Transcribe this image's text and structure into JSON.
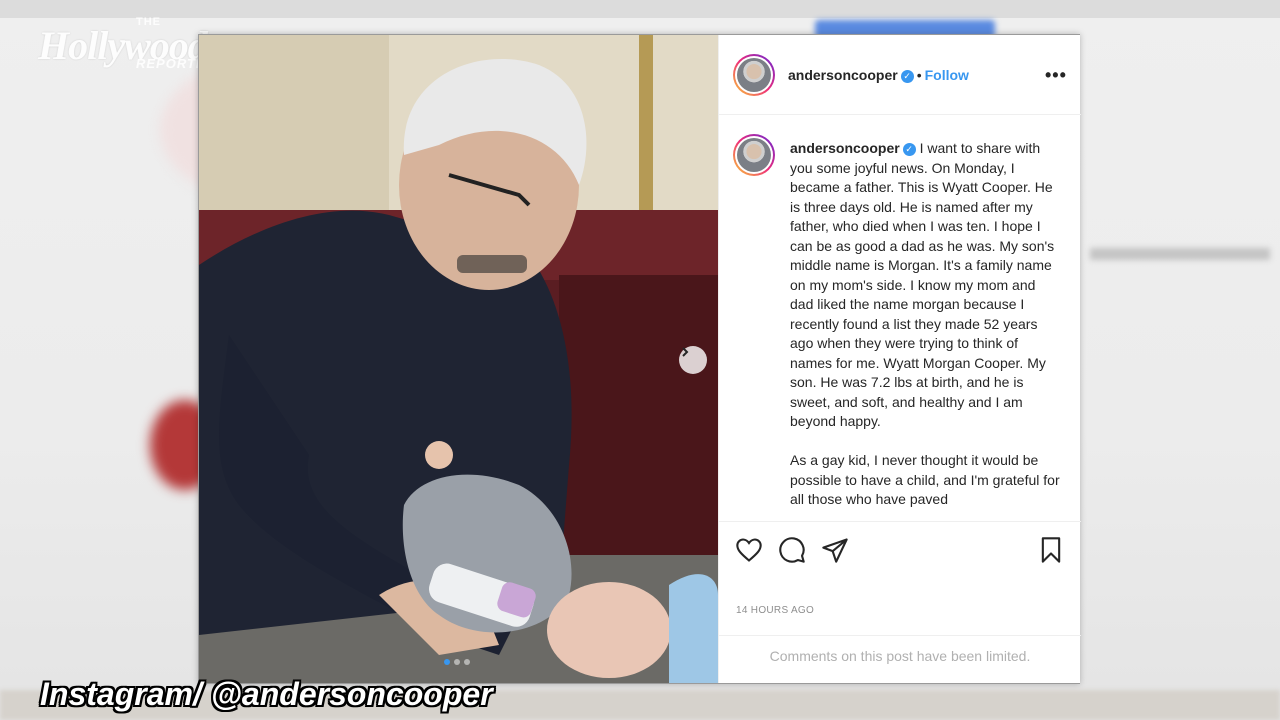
{
  "watermark": {
    "top": "THE",
    "word": "Hollywood",
    "bottom": "REPORTER"
  },
  "post": {
    "username": "andersoncooper",
    "verified_mark": "✓",
    "separator": "•",
    "follow_label": "Follow",
    "more_label": "•••",
    "caption_paragraphs": [
      "I want to share with you some joyful news. On Monday, I became a father. This is Wyatt Cooper. He is three days old. He is named after my father, who died when I was ten. I hope I can be as good a dad as he was. My son's middle name is Morgan. It's a family name on my mom's side. I know my mom and dad liked the name morgan because I recently found a list they made 52 years ago when they were trying to think of names for me. Wyatt Morgan Cooper. My son. He was 7.2 lbs at birth, and he is sweet, and soft, and healthy and I am beyond happy.",
      "As a gay kid, I never thought it would be possible to have a child, and I'm grateful for all those who have paved"
    ],
    "timestamp": "14 HOURS AGO",
    "comments_notice": "Comments on this post have been limited.",
    "carousel_total": 3,
    "carousel_active": 1
  },
  "icons": {
    "like": "heart-icon",
    "comment": "comment-icon",
    "share": "paper-plane-icon",
    "save": "bookmark-icon",
    "next": "chevron-right-icon"
  },
  "colors": {
    "accent": "#3897f0",
    "text": "#262626",
    "muted": "#8e8e8e"
  },
  "credit": "Instagram/ @andersoncooper"
}
